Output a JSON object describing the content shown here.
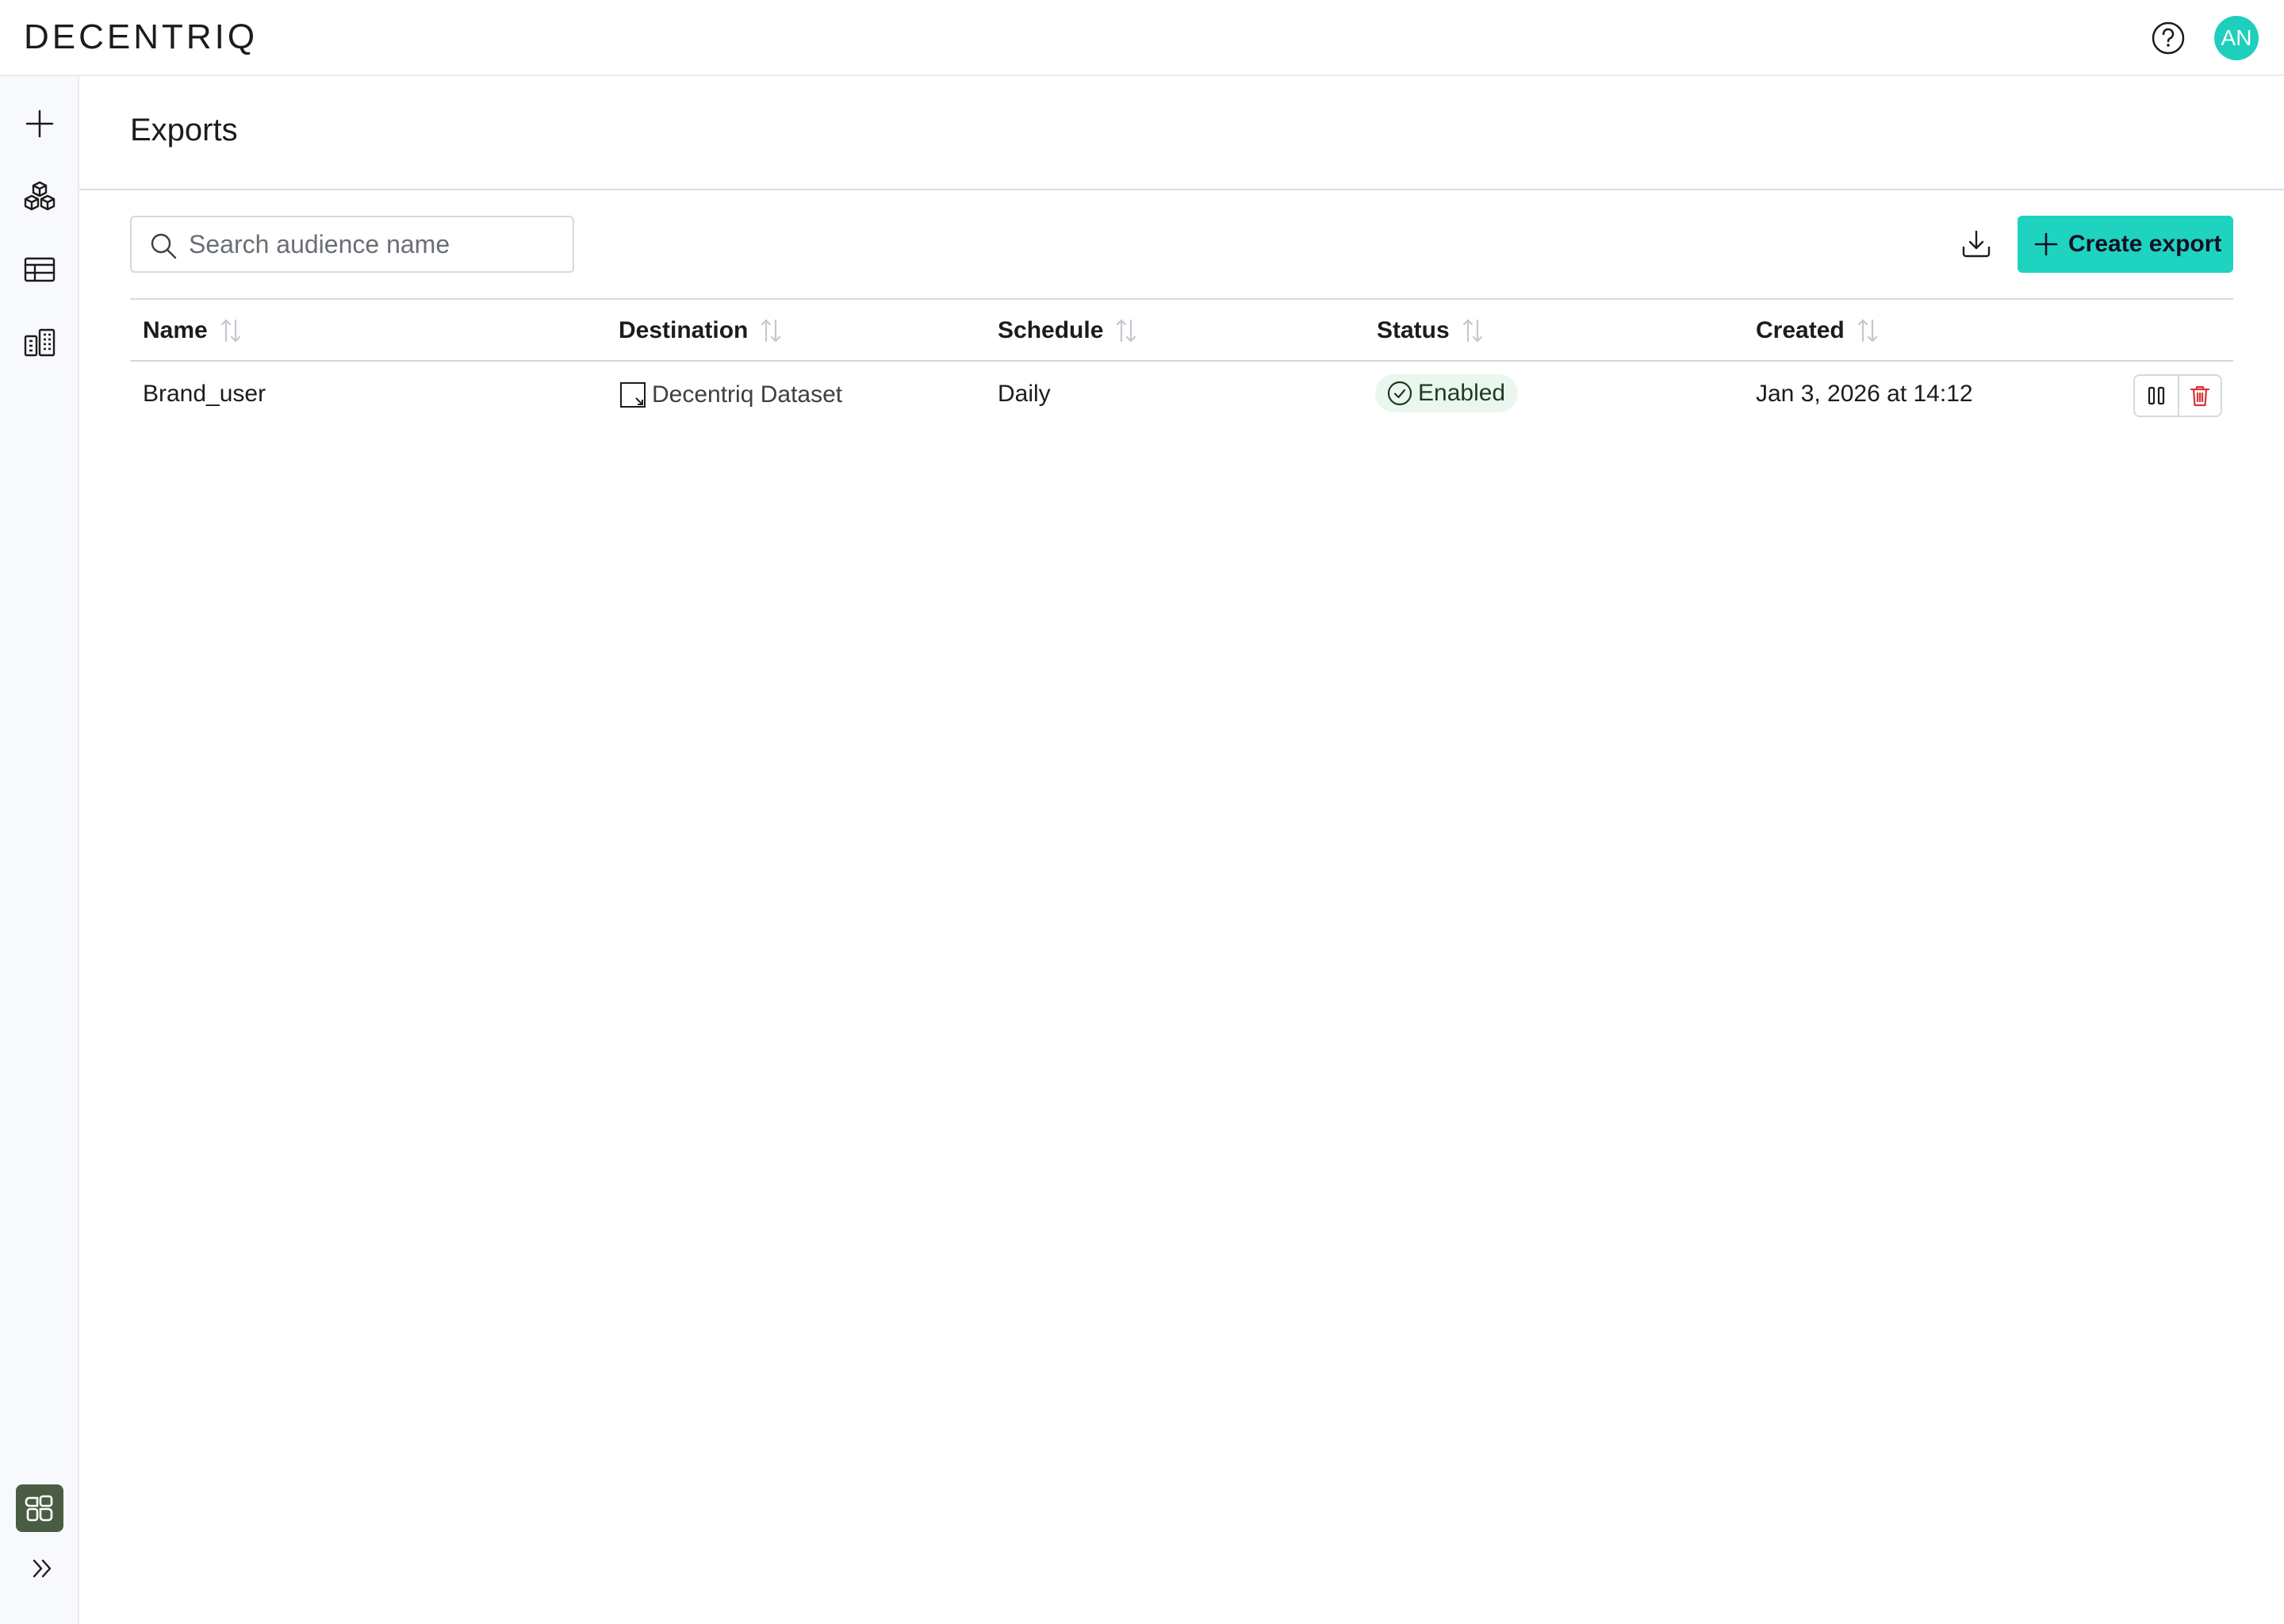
{
  "app": {
    "logo": "DECENTRIQ",
    "user_initials": "AN"
  },
  "sidebar": {
    "items": [
      {
        "name": "new",
        "icon": "plus-icon"
      },
      {
        "name": "data-clean-rooms",
        "icon": "cubes-icon"
      },
      {
        "name": "datasets",
        "icon": "table-icon"
      },
      {
        "name": "organizations",
        "icon": "buildings-icon"
      }
    ],
    "bottom": [
      {
        "name": "apps",
        "icon": "apps-grid-icon"
      },
      {
        "name": "expand",
        "icon": "chevrons-right-icon"
      }
    ]
  },
  "page": {
    "title": "Exports"
  },
  "toolbar": {
    "search_placeholder": "Search audience name",
    "create_label": "Create export"
  },
  "table": {
    "columns": [
      "Name",
      "Destination",
      "Schedule",
      "Status",
      "Created"
    ],
    "rows": [
      {
        "name": "Brand_user",
        "destination": "Decentriq Dataset",
        "schedule": "Daily",
        "status": "Enabled",
        "created": "Jan 3, 2026 at 14:12"
      }
    ]
  },
  "colors": {
    "accent": "#1fd3c1",
    "avatar": "#1fcfbd",
    "status_bg": "#eaf7ee",
    "danger": "#d6333a"
  }
}
